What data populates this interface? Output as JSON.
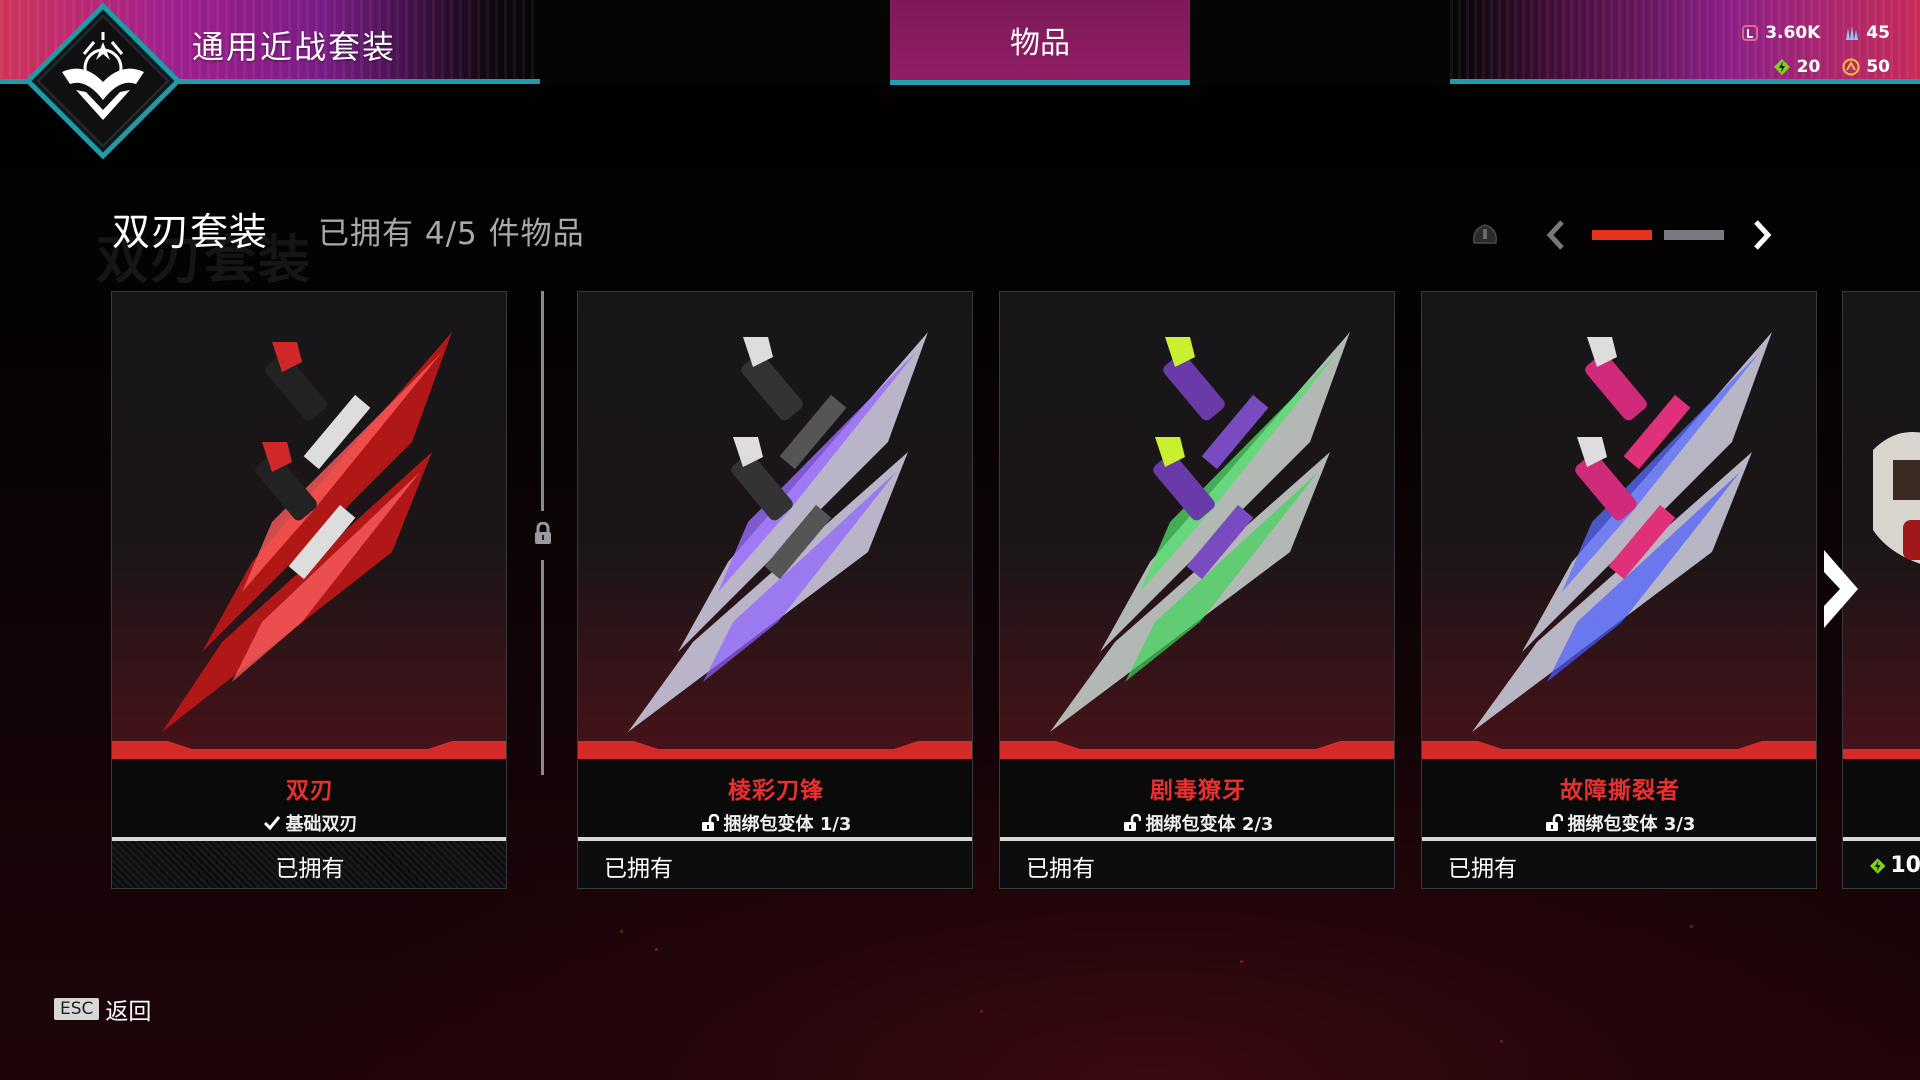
{
  "header": {
    "bundle_title": "通用近战套装",
    "tab_label": "物品"
  },
  "currency": {
    "crafting_metals": "3.60K",
    "exotic_shards": "45",
    "legend_tokens": "20",
    "apex_coins": "50"
  },
  "set": {
    "title": "双刃套装",
    "ghost_title": "双刃套装",
    "owned_text": "已拥有 4/5 件物品"
  },
  "pager": {
    "current_page": 1,
    "total_pages": 2
  },
  "cards": [
    {
      "name": "双刃",
      "variant": "基础双刃",
      "variant_icon": "check-icon",
      "status": "已拥有",
      "accent": "#e33b3b"
    },
    {
      "name": "棱彩刀锋",
      "variant": "捆绑包变体 1/3",
      "variant_icon": "unlock-icon",
      "status": "已拥有",
      "accent": "#9b6bff"
    },
    {
      "name": "剧毒獠牙",
      "variant": "捆绑包变体 2/3",
      "variant_icon": "unlock-icon",
      "status": "已拥有",
      "accent": "#4fe06a"
    },
    {
      "name": "故障撕裂者",
      "variant": "捆绑包变体 3/3",
      "variant_icon": "unlock-icon",
      "status": "已拥有",
      "accent": "#e0307a"
    }
  ],
  "partial_card": {
    "price": "10"
  },
  "footer": {
    "esc_key": "ESC",
    "back_label": "返回"
  },
  "colors": {
    "accent_red": "#e2341f",
    "teal": "#1f9aa7",
    "tab_bg": "#8f1e63"
  }
}
